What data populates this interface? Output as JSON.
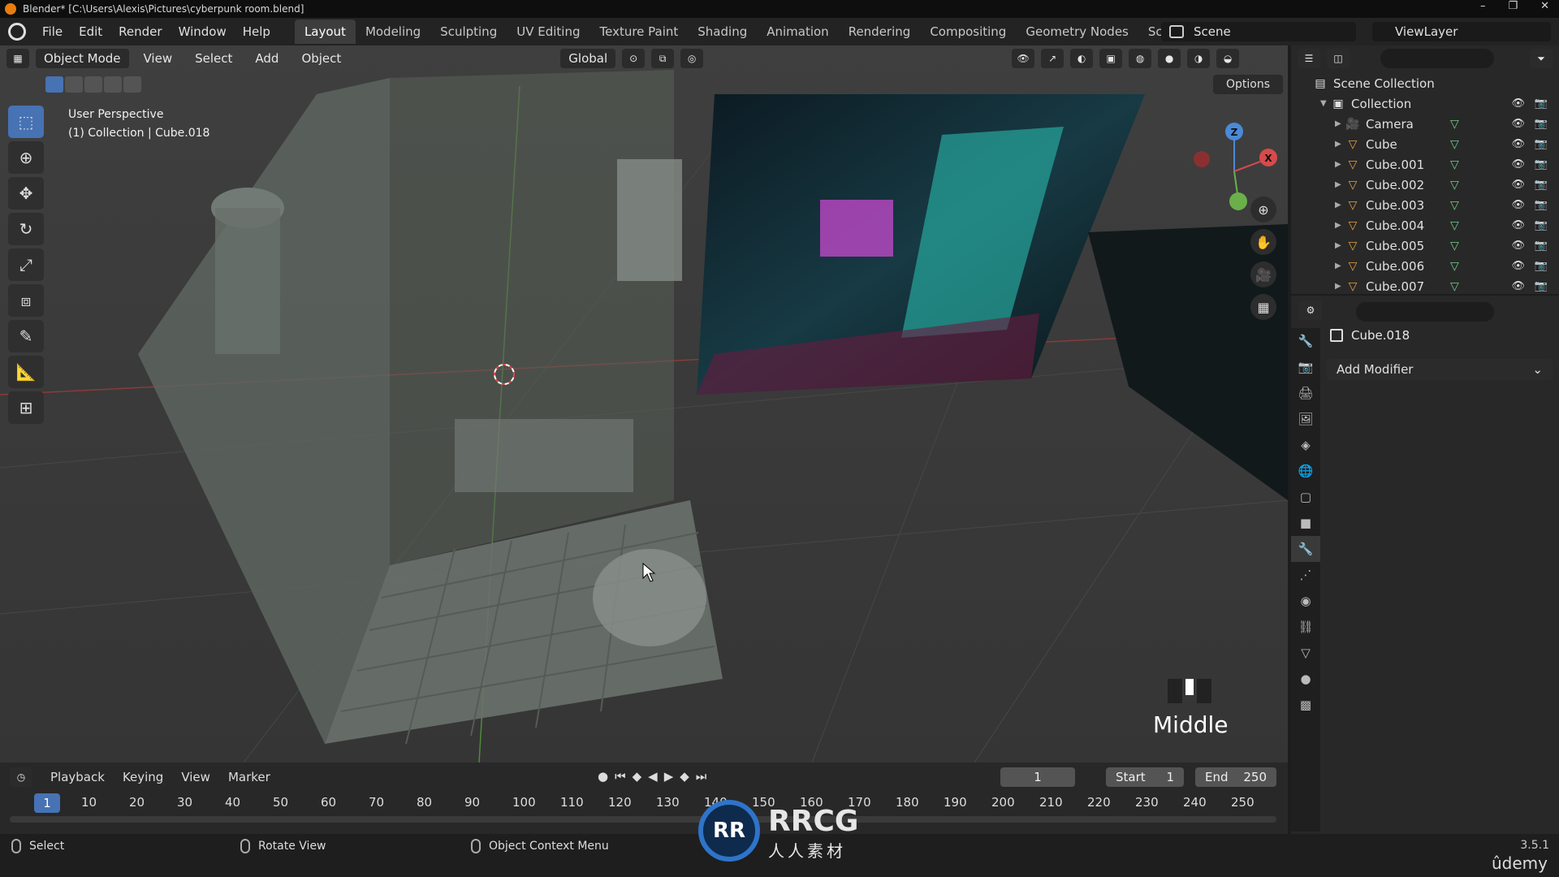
{
  "window": {
    "title": "Blender* [C:\\Users\\Alexis\\Pictures\\cyberpunk room.blend]",
    "controls": [
      "–",
      "❐",
      "✕"
    ],
    "watermark": "RRCG.cn"
  },
  "menubar": {
    "items": [
      "File",
      "Edit",
      "Render",
      "Window",
      "Help"
    ],
    "workspaces": [
      "Layout",
      "Modeling",
      "Sculpting",
      "UV Editing",
      "Texture Paint",
      "Shading",
      "Animation",
      "Rendering",
      "Compositing",
      "Geometry Nodes",
      "Scripting"
    ],
    "active_workspace": "Layout",
    "scene": "Scene",
    "view_layer": "ViewLayer"
  },
  "viewport": {
    "mode": "Object Mode",
    "menus": [
      "View",
      "Select",
      "Add",
      "Object"
    ],
    "orientation": "Global",
    "options_label": "Options",
    "info_line1": "User Perspective",
    "info_line2": "(1) Collection | Cube.018",
    "gizmo": {
      "z": "Z",
      "x": "X"
    },
    "mouse_hint": "Middle",
    "accent_color": "#4772b3"
  },
  "timeline": {
    "menus": [
      "Playback",
      "Keying",
      "View",
      "Marker"
    ],
    "current_frame": "1",
    "start_label": "Start",
    "start_value": "1",
    "end_label": "End",
    "end_value": "250",
    "ruler": [
      "1",
      "10",
      "20",
      "30",
      "40",
      "50",
      "60",
      "70",
      "80",
      "90",
      "100",
      "110",
      "120",
      "130",
      "140",
      "150",
      "160",
      "170",
      "180",
      "190",
      "200",
      "210",
      "220",
      "230",
      "240",
      "250"
    ]
  },
  "statusbar": {
    "select": "Select",
    "rotate": "Rotate View",
    "context": "Object Context Menu",
    "version": "3.5.1",
    "brand": "ûdemy"
  },
  "outliner": {
    "root": "Scene Collection",
    "collection": "Collection",
    "items": [
      {
        "name": "Camera",
        "type": "camera"
      },
      {
        "name": "Cube",
        "type": "mesh"
      },
      {
        "name": "Cube.001",
        "type": "mesh"
      },
      {
        "name": "Cube.002",
        "type": "mesh"
      },
      {
        "name": "Cube.003",
        "type": "mesh"
      },
      {
        "name": "Cube.004",
        "type": "mesh"
      },
      {
        "name": "Cube.005",
        "type": "mesh"
      },
      {
        "name": "Cube.006",
        "type": "mesh"
      },
      {
        "name": "Cube.007",
        "type": "mesh"
      }
    ]
  },
  "properties": {
    "object_name": "Cube.018",
    "add_modifier": "Add Modifier"
  },
  "watermark": {
    "logo": "RR",
    "text": "RRCG",
    "sub": "人人素材"
  }
}
